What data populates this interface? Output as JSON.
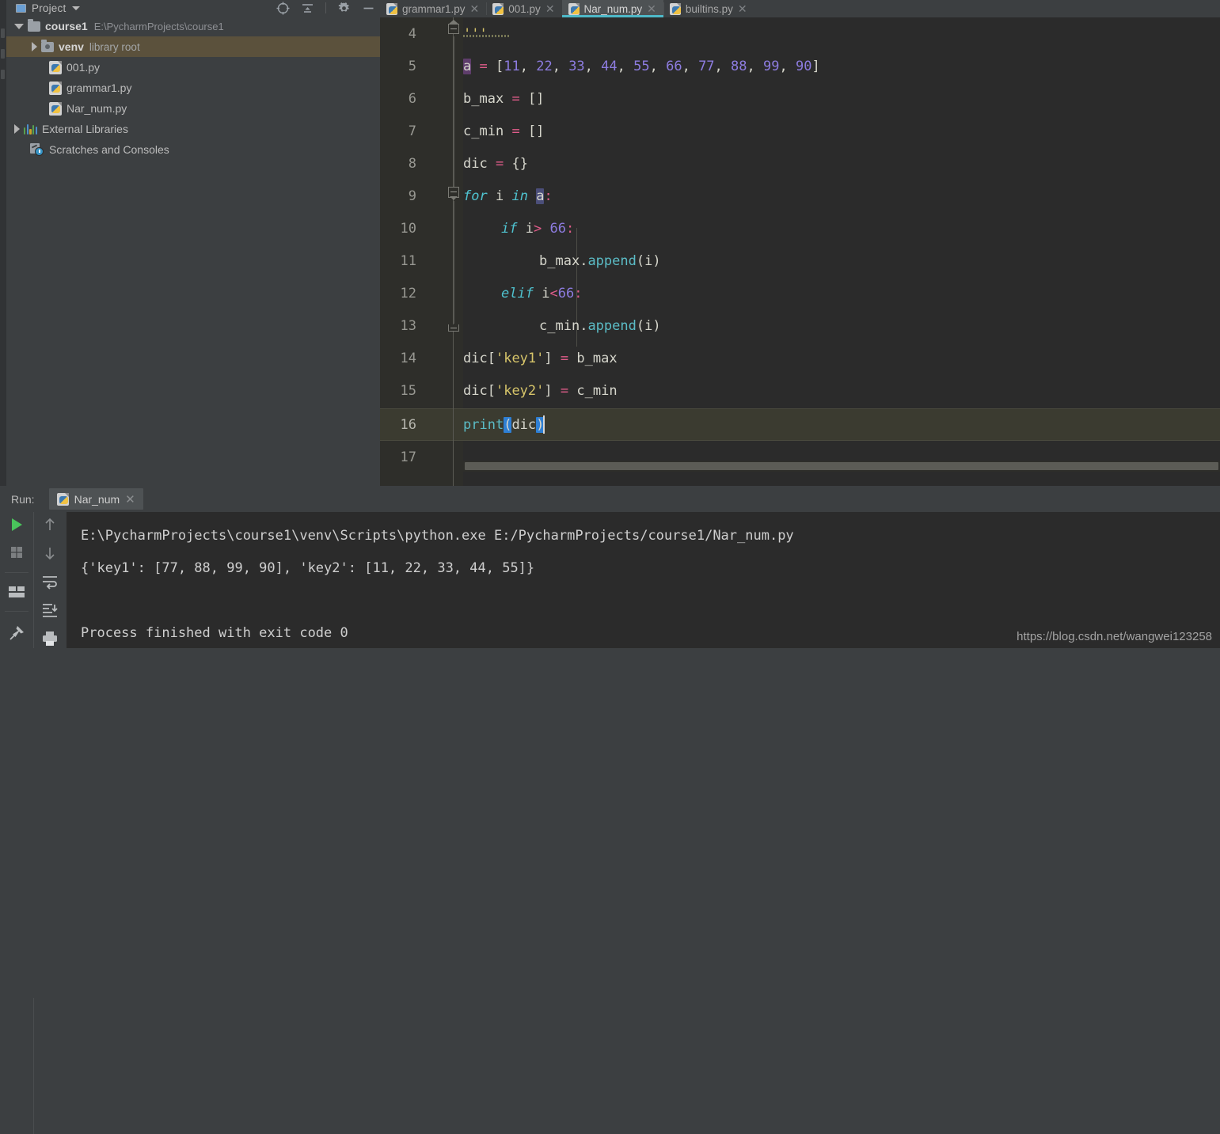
{
  "project_panel": {
    "header": {
      "title": "Project",
      "icon": "project-icon",
      "caret": "chevron-down-icon",
      "tools": [
        "locate-target-icon",
        "collapse-all-icon",
        "settings-gear-icon",
        "minimize-icon"
      ]
    },
    "tree": [
      {
        "label": "course1",
        "detail": "E:\\PycharmProjects\\course1",
        "icon": "folder-icon",
        "arrow": "down",
        "depth": 0,
        "bold": true,
        "selected": false
      },
      {
        "label": "venv",
        "detail": "library root",
        "icon": "folder-lib-icon",
        "arrow": "right",
        "depth": 1,
        "bold": true,
        "selected": true
      },
      {
        "label": "001.py",
        "detail": "",
        "icon": "python-file-icon",
        "arrow": "none",
        "depth": 2,
        "bold": false,
        "selected": false
      },
      {
        "label": "grammar1.py",
        "detail": "",
        "icon": "python-file-icon",
        "arrow": "none",
        "depth": 2,
        "bold": false,
        "selected": false
      },
      {
        "label": "Nar_num.py",
        "detail": "",
        "icon": "python-file-icon",
        "arrow": "none",
        "depth": 2,
        "bold": false,
        "selected": false
      },
      {
        "label": "External Libraries",
        "detail": "",
        "icon": "libraries-bars-icon",
        "arrow": "right",
        "depth": 0,
        "bold": false,
        "selected": false
      },
      {
        "label": "Scratches and Consoles",
        "detail": "",
        "icon": "scratches-icon",
        "arrow": "none",
        "depth": 0,
        "bold": false,
        "selected": false
      }
    ]
  },
  "editor": {
    "tabs": [
      {
        "label": "grammar1.py",
        "active": false,
        "closable": true
      },
      {
        "label": "001.py",
        "active": false,
        "closable": true
      },
      {
        "label": "Nar_num.py",
        "active": true,
        "closable": true
      },
      {
        "label": "builtins.py",
        "active": false,
        "closable": true
      }
    ],
    "active_tab_accent": "#4eb8c8",
    "first_visible_line": 4,
    "caret_line": 16,
    "lines": [
      {
        "n": 4,
        "text": "'''"
      },
      {
        "n": 5,
        "text": "a = [11, 22, 33, 44, 55, 66, 77, 88, 99, 90]"
      },
      {
        "n": 6,
        "text": "b_max = []"
      },
      {
        "n": 7,
        "text": "c_min = []"
      },
      {
        "n": 8,
        "text": "dic = {}"
      },
      {
        "n": 9,
        "text": "for i in a:"
      },
      {
        "n": 10,
        "text": "    if i> 66:"
      },
      {
        "n": 11,
        "text": "        b_max.append(i)"
      },
      {
        "n": 12,
        "text": "    elif i<66:"
      },
      {
        "n": 13,
        "text": "        c_min.append(i)"
      },
      {
        "n": 14,
        "text": "dic['key1'] = b_max"
      },
      {
        "n": 15,
        "text": "dic['key2'] = c_min"
      },
      {
        "n": 16,
        "text": "print(dic)"
      },
      {
        "n": 17,
        "text": ""
      }
    ],
    "tokens": {
      "line5": {
        "var": "a",
        "eq": "=",
        "open": "[",
        "nums": [
          "11",
          "22",
          "33",
          "44",
          "55",
          "66",
          "77",
          "88",
          "99",
          "90"
        ],
        "close": "]"
      },
      "line6": {
        "var": "b_max",
        "eq": "=",
        "val": "[]"
      },
      "line7": {
        "var": "c_min",
        "eq": "=",
        "val": "[]"
      },
      "line8": {
        "var": "dic",
        "eq": "=",
        "val": "{}"
      },
      "line9": {
        "kw1": "for",
        "v": "i",
        "kw2": "in",
        "it": "a",
        "colon": ":"
      },
      "line10": {
        "kw": "if",
        "v": "i",
        "op": ">",
        "num": "66",
        "colon": ":"
      },
      "line11": {
        "obj": "b_max",
        "dot": ".",
        "fn": "append",
        "args": "(i)"
      },
      "line12": {
        "kw": "elif",
        "v": "i",
        "op": "<",
        "num": "66",
        "colon": ":"
      },
      "line13": {
        "obj": "c_min",
        "dot": ".",
        "fn": "append",
        "args": "(i)"
      },
      "line14": {
        "obj": "dic",
        "lb": "[",
        "str": "'key1'",
        "rb": "]",
        "eq": "=",
        "val": "b_max"
      },
      "line15": {
        "obj": "dic",
        "lb": "[",
        "str": "'key2'",
        "rb": "]",
        "eq": "=",
        "val": "c_min"
      },
      "line16": {
        "fn": "print",
        "lp": "(",
        "arg": "dic",
        "rp": ")"
      },
      "line4": {
        "docstring": "'''"
      }
    },
    "colors": {
      "background": "#2b2b2b",
      "gutter": "#2e2e2a",
      "current_line": "#3b3b30",
      "keyword": "#4fc3d0",
      "number": "#8d7ce0",
      "operator": "#e05c8a",
      "string": "#d7c56a",
      "function": "#5bbcc6",
      "default_text": "#d6d6cc",
      "identifier_highlight": "#5e3d6b",
      "bracket_highlight": "#2e7fd4"
    }
  },
  "run_panel": {
    "label": "Run:",
    "tab": {
      "label": "Nar_num",
      "icon": "python-file-icon",
      "close": "close-icon"
    },
    "toolbar_left": [
      "run-icon",
      "stop-icon",
      "layout-icon",
      "pin-icon"
    ],
    "toolbar_right": [
      "up-arrow-icon",
      "down-arrow-icon",
      "soft-wrap-icon",
      "scroll-to-end-icon",
      "print-icon"
    ],
    "console_lines": [
      "E:\\PycharmProjects\\course1\\venv\\Scripts\\python.exe E:/PycharmProjects/course1/Nar_num.py",
      "{'key1': [77, 88, 99, 90], 'key2': [11, 22, 33, 44, 55]}",
      "",
      "Process finished with exit code 0"
    ]
  },
  "watermark": "https://blog.csdn.net/wangwei123258"
}
